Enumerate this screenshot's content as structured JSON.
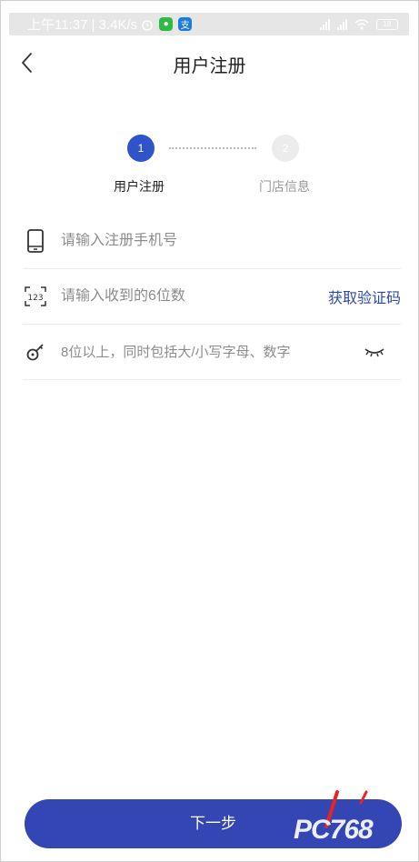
{
  "status_bar": {
    "time_speed": "上午11:37 | 3.4K/s",
    "alarm_icon": "alarm-icon",
    "app_icons": [
      "wechat-icon",
      "alipay-icon"
    ],
    "signal_icons": [
      "signal-icon",
      "signal-icon",
      "wifi-icon"
    ],
    "battery": "18"
  },
  "header": {
    "title": "用户注册",
    "back_icon": "chevron-left-icon"
  },
  "stepper": {
    "steps": [
      {
        "number": "1",
        "label": "用户注册",
        "active": true
      },
      {
        "number": "2",
        "label": "门店信息",
        "active": false
      }
    ]
  },
  "form": {
    "phone": {
      "placeholder": "请输入注册手机号",
      "icon": "phone-icon"
    },
    "code": {
      "placeholder": "请输入收到的6位数",
      "icon": "code-123-icon",
      "action_label": "获取验证码"
    },
    "password": {
      "placeholder": "8位以上，同时包括大/小写字母、数字",
      "icon": "key-icon",
      "toggle_icon": "eye-closed-icon"
    }
  },
  "footer": {
    "next_label": "下一步"
  },
  "watermark": {
    "text": "PC768"
  },
  "colors": {
    "accent": "#2f54c9",
    "button": "#3446b4",
    "link": "#2c4aa8"
  }
}
